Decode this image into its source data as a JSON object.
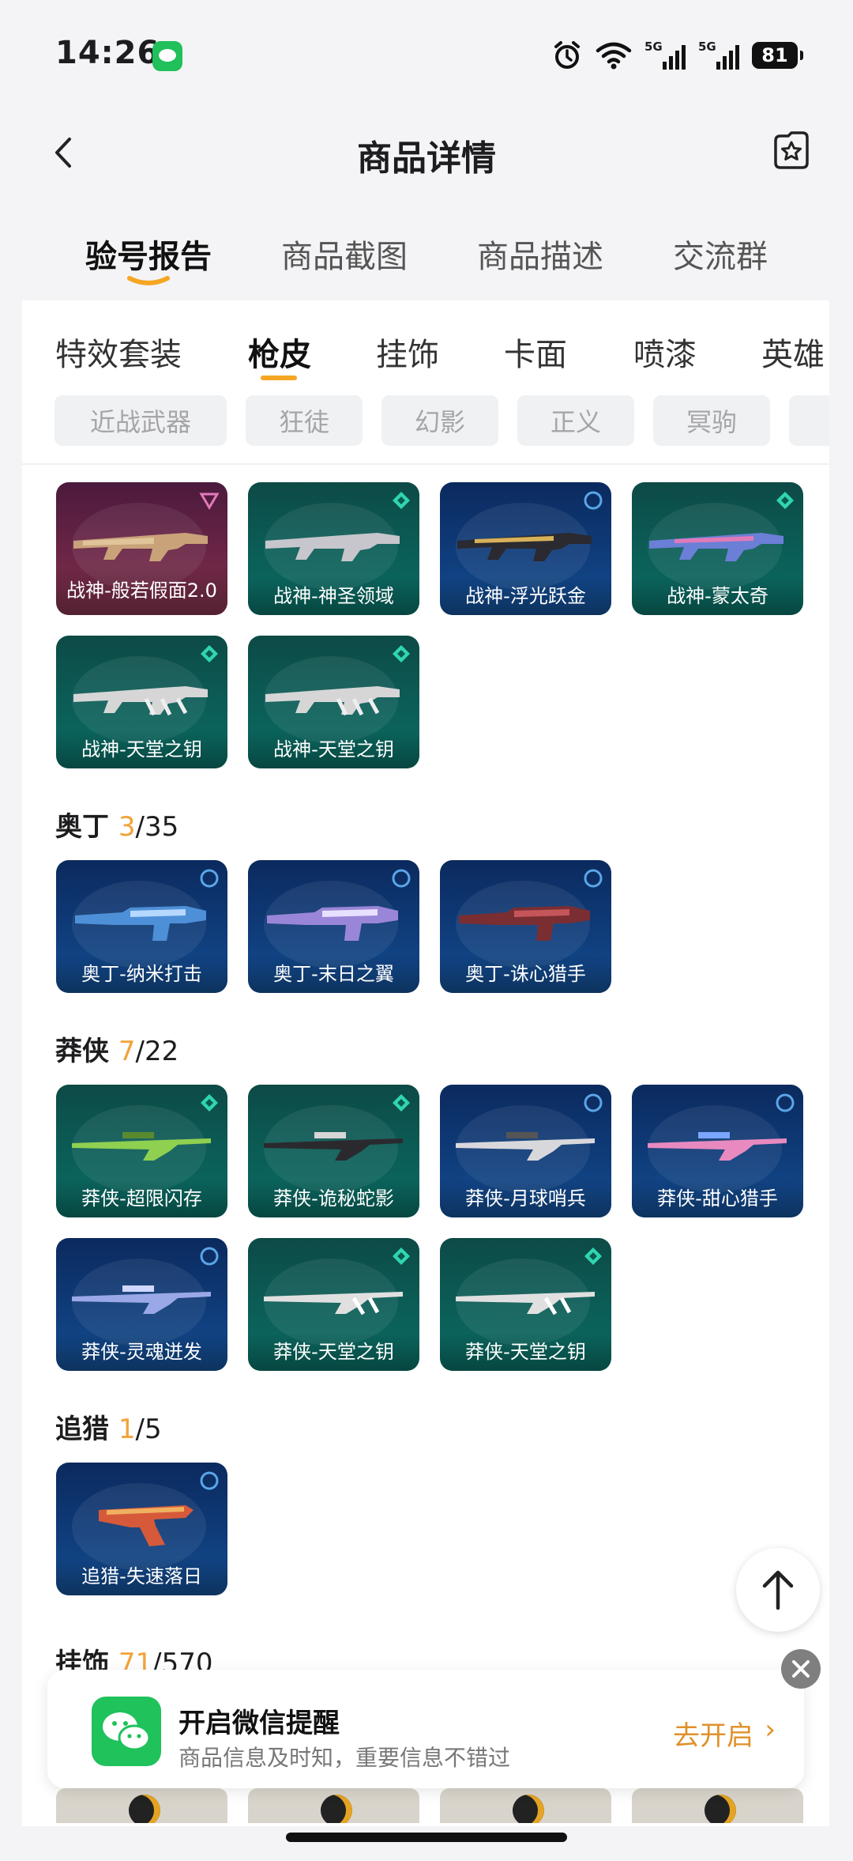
{
  "status": {
    "time": "14:26",
    "signal1": "5G",
    "signal2": "5G",
    "battery": "81"
  },
  "nav": {
    "title": "商品详情"
  },
  "tabs": [
    "验号报告",
    "商品截图",
    "商品描述",
    "交流群"
  ],
  "subtabs": [
    "特效套装",
    "枪皮",
    "挂饰",
    "卡面",
    "喷漆",
    "英雄"
  ],
  "chips": [
    "近战武器",
    "狂徒",
    "幻影",
    "正义",
    "冥驹"
  ],
  "colors": {
    "accent": "#f2a23a",
    "tab_indicator": "#f5a623"
  },
  "zhanshen_cards": [
    {
      "label": "战神-般若假面2.0",
      "rarity": "exclusive"
    },
    {
      "label": "战神-神圣领域",
      "rarity": "premium"
    },
    {
      "label": "战神-浮光跃金",
      "rarity": "deluxe"
    },
    {
      "label": "战神-蒙太奇",
      "rarity": "premium"
    },
    {
      "label": "战神-天堂之钥",
      "rarity": "premium"
    },
    {
      "label": "战神-天堂之钥",
      "rarity": "premium"
    }
  ],
  "odin": {
    "name": "奥丁",
    "owned": "3",
    "total": "/35",
    "cards": [
      "奥丁-纳米打击",
      "奥丁-末日之翼",
      "奥丁-诛心猎手"
    ]
  },
  "mangxia": {
    "name": "莽侠",
    "owned": "7",
    "total": "/22",
    "cards": [
      "莽侠-超限闪存",
      "莽侠-诡秘蛇影",
      "莽侠-月球哨兵",
      "莽侠-甜心猎手",
      "莽侠-灵魂迸发",
      "莽侠-天堂之钥",
      "莽侠-天堂之钥"
    ]
  },
  "zhuilie": {
    "name": "追猎",
    "owned": "1",
    "total": "/5",
    "cards": [
      "追猎-失速落日"
    ]
  },
  "guashi": {
    "name": "挂饰",
    "owned": "71",
    "total": "/570"
  },
  "banner": {
    "title": "开启微信提醒",
    "subtitle": "商品信息及时知，重要信息不错过",
    "action": "去开启",
    "chevron": "›"
  }
}
